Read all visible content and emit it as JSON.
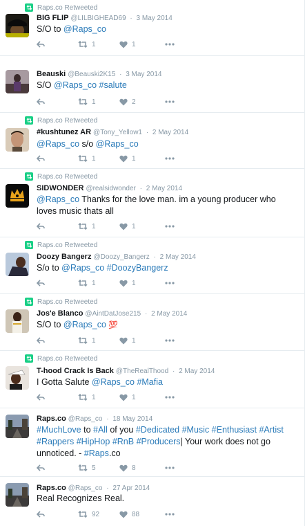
{
  "tweets": [
    {
      "retweeted_label": "Raps.co Retweeted",
      "name": "BIG FLIP",
      "handle": "@LILBIGHEAD69",
      "date": "3 May 2014",
      "text": [
        "S/O to ",
        {
          "link": "@Raps_co"
        }
      ],
      "retweets": "1",
      "likes": "1",
      "avatar": "avatar-man-black-cap"
    },
    {
      "retweeted_label": "",
      "name": "Beauski",
      "handle": "@Beauski2K15",
      "date": "3 May 2014",
      "text": [
        "S/O ",
        {
          "link": "@Raps_co"
        },
        " ",
        {
          "link": "#salute"
        }
      ],
      "retweets": "1",
      "likes": "2",
      "avatar": "avatar-person-street"
    },
    {
      "retweeted_label": "Raps.co Retweeted",
      "name": "#kushtunez AR",
      "handle": "@Tony_Yellow1",
      "date": "2 May 2014",
      "text": [
        {
          "link": "@Raps_co"
        },
        " s/o ",
        {
          "link": "@Raps_co"
        }
      ],
      "retweets": "1",
      "likes": "1",
      "avatar": "avatar-man-face"
    },
    {
      "retweeted_label": "Raps.co Retweeted",
      "name": "SIDWONDER",
      "handle": "@realsidwonder",
      "date": "2 May 2014",
      "text": [
        {
          "link": "@Raps_co"
        },
        " Thanks for the love man.  im a young producer who loves music thats all"
      ],
      "retweets": "1",
      "likes": "1",
      "avatar": "avatar-crown-logo"
    },
    {
      "retweeted_label": "Raps.co Retweeted",
      "name": "Doozy Bangerz",
      "handle": "@Doozy_Bangerz",
      "date": "2 May 2014",
      "text": [
        "S/o to ",
        {
          "link": "@Raps_co"
        },
        "  ",
        {
          "link": "#DoozyBangerz"
        }
      ],
      "retweets": "1",
      "likes": "1",
      "avatar": "avatar-man-sky"
    },
    {
      "retweeted_label": "Raps.co Retweeted",
      "name": "Jos'e Blanco",
      "handle": "@AintDatJose215",
      "date": "2 May 2014",
      "text": [
        "S/O to ",
        {
          "link": "@Raps_co"
        },
        " ",
        {
          "emoji": "💯"
        }
      ],
      "retweets": "1",
      "likes": "1",
      "avatar": "avatar-man-white-shirt"
    },
    {
      "retweeted_label": "Raps.co Retweeted",
      "name": "T-hood Crack Is Back",
      "handle": "@TheRealThood",
      "date": "2 May 2014",
      "text": [
        "I Gotta Salute ",
        {
          "link": "@Raps_co"
        },
        " ",
        {
          "link": "#Mafia"
        }
      ],
      "retweets": "1",
      "likes": "1",
      "avatar": "avatar-man-hat"
    },
    {
      "retweeted_label": "",
      "name": "Raps.co",
      "handle": "@Raps_co",
      "date": "18 May 2014",
      "text": [
        {
          "link": "#MuchLove"
        },
        " to ",
        {
          "link": "#All"
        },
        " of you ",
        {
          "link": "#Dedicated"
        },
        " ",
        {
          "link": "#Music"
        },
        " ",
        {
          "link": "#Enthusiast"
        },
        " ",
        {
          "link": "#Artist"
        },
        " ",
        {
          "link": "#Rappers"
        },
        " ",
        {
          "link": "#HipHop"
        },
        " ",
        {
          "link": "#RnB"
        },
        " ",
        {
          "link": "#Producers"
        },
        "| Your work does not go unnoticed. - ",
        {
          "link": "#Raps"
        },
        ".co"
      ],
      "retweets": "5",
      "likes": "8",
      "avatar": "avatar-raps-street"
    },
    {
      "retweeted_label": "",
      "name": "Raps.co",
      "handle": "@Raps_co",
      "date": "27 Apr 2014",
      "text": [
        "Real Recognizes Real."
      ],
      "retweets": "92",
      "likes": "88",
      "avatar": "avatar-raps-street"
    }
  ],
  "colors": {
    "link": "#2b7bb9",
    "muted": "#8899a6",
    "retweet_badge": "#19cf86",
    "divider": "#e6ecf0"
  },
  "icons": {
    "reply": "reply-icon",
    "retweet": "retweet-icon",
    "like": "heart-icon",
    "more": "more-icon",
    "retweeted": "retweet-badge-icon"
  }
}
